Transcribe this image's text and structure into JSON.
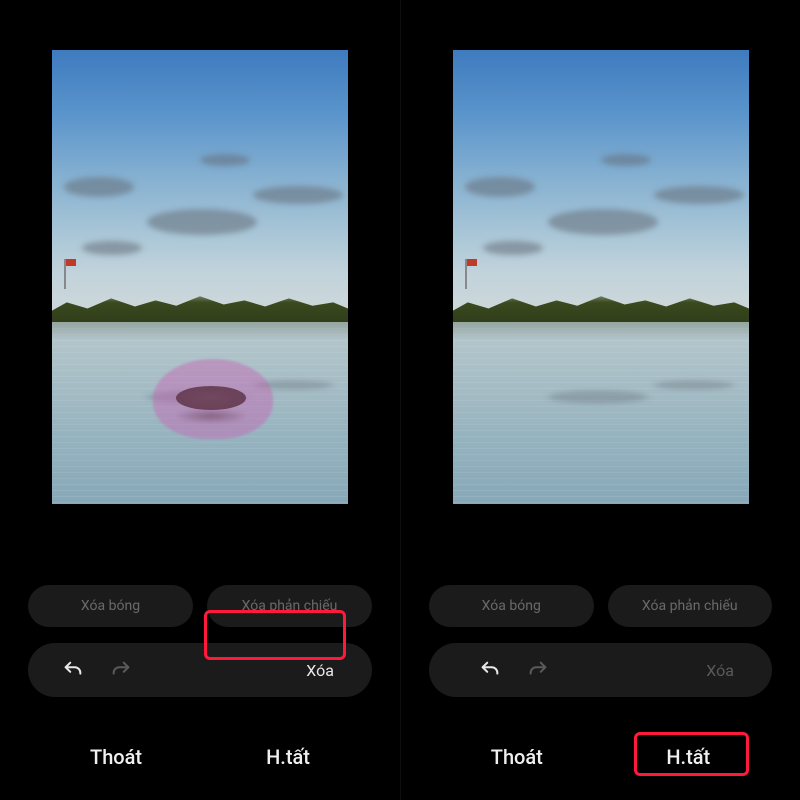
{
  "left": {
    "pill_shadow": "Xóa bóng",
    "pill_reflection": "Xóa phản chiếu",
    "action_label": "Xóa",
    "exit_label": "Thoát",
    "done_label": "H.tất",
    "has_selection": true,
    "highlighted": "action"
  },
  "right": {
    "pill_shadow": "Xóa bóng",
    "pill_reflection": "Xóa phản chiếu",
    "action_label": "Xóa",
    "exit_label": "Thoát",
    "done_label": "H.tất",
    "has_selection": false,
    "highlighted": "done"
  },
  "icons": {
    "undo": "undo-icon",
    "redo": "redo-icon"
  }
}
